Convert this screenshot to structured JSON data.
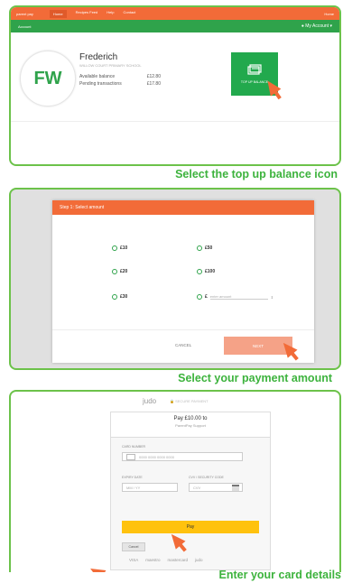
{
  "panel1": {
    "topbar": {
      "brand": "parent pay",
      "nav": [
        "Home",
        "Recipes Feed",
        "Help",
        "Contact"
      ],
      "right": "Home"
    },
    "greenbar": {
      "left": "Account",
      "right": "My Account"
    },
    "account": {
      "initials": "FW",
      "name": "Frederich",
      "subtitle": "WILLOW COURT PRIMARY SCHOOL",
      "available_label": "Available balance",
      "available_value": "£12.80",
      "pending_label": "Pending transactions",
      "pending_value": "£17.80"
    },
    "topup_label": "TOP UP BALANCE",
    "caption": "Select the top up balance icon"
  },
  "panel2": {
    "header": "Step 1: Select amount",
    "amounts_left": [
      "£10",
      "£20",
      "£30"
    ],
    "amounts_right": [
      "£50",
      "£100"
    ],
    "custom_symbol": "£",
    "custom_placeholder": "enter amount",
    "cancel": "CANCEL",
    "next": "NEXT",
    "caption": "Select your payment amount"
  },
  "panel3": {
    "logo": "judo",
    "secured": "SECURE PAYMENT",
    "pay_title": "Pay £10.00 to",
    "pay_subtitle": "ParentPay Support",
    "card_number_label": "CARD NUMBER",
    "card_number_placeholder": "0000 0000 0000 0000",
    "expiry_label": "EXPIRY DATE",
    "expiry_placeholder": "MM / YY",
    "cvv_label": "CVV / SECURITY CODE",
    "cvv_placeholder": "CVV",
    "pay_button": "Pay",
    "cancel_button": "Cancel",
    "card_logos": [
      "VISA",
      "maestro",
      "mastercard",
      "judo"
    ],
    "caption": "Enter your card details"
  },
  "colors": {
    "orange": "#f26b38",
    "green": "#2fa34b",
    "caption_green": "#3db33d",
    "pay_yellow": "#ffc20e"
  }
}
